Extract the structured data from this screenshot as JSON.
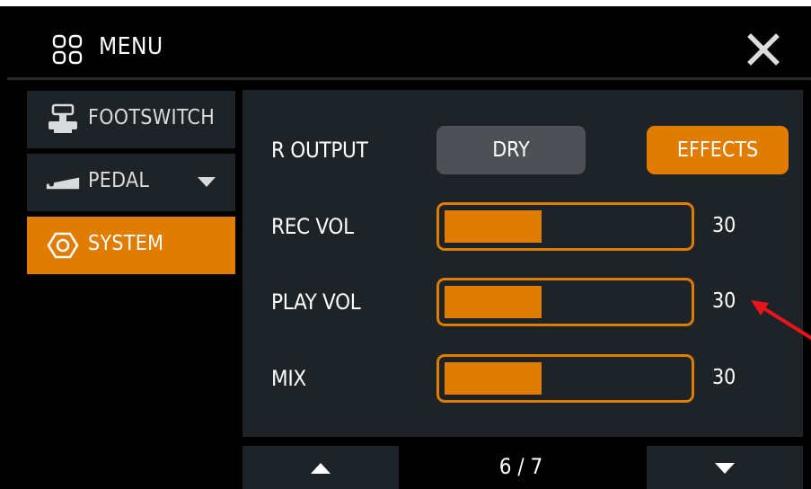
{
  "header": {
    "title": "MENU",
    "menu_icon": "grid-icon",
    "close_icon": "close-icon"
  },
  "sidebar": {
    "items": [
      {
        "label": "FOOTSWITCH",
        "icon": "footswitch-icon",
        "active": false
      },
      {
        "label": "PEDAL",
        "icon": "pedal-icon",
        "active": false,
        "has_dropdown": true
      },
      {
        "label": "SYSTEM",
        "icon": "hexagon-gear-icon",
        "active": true
      }
    ]
  },
  "main": {
    "r_output": {
      "label": "R OUTPUT",
      "options": [
        "DRY",
        "EFFECTS"
      ],
      "selected": "EFFECTS"
    },
    "rec_vol": {
      "label": "REC VOL",
      "value": "30",
      "fill_fraction": 0.3
    },
    "play_vol": {
      "label": "PLAY VOL",
      "value": "30",
      "fill_fraction": 0.3
    },
    "mix": {
      "label": "MIX",
      "value": "30",
      "fill_fraction": 0.3
    }
  },
  "footer": {
    "page_indicator": "6 / 7"
  },
  "colors": {
    "accent": "#e07c00",
    "panel": "#1e2327",
    "inactive_button": "#4d5155",
    "annotation_arrow": "#e8141c"
  }
}
